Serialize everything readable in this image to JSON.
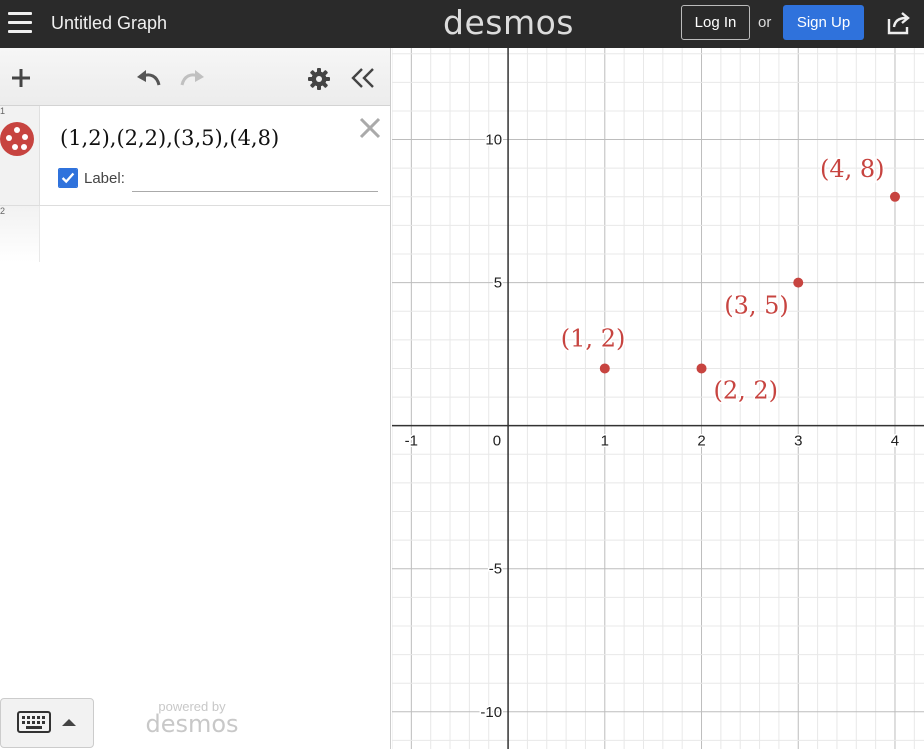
{
  "header": {
    "title": "Untitled Graph",
    "logo": "desmos",
    "login_label": "Log In",
    "or_text": "or",
    "signup_label": "Sign Up",
    "signup_color": "#2f72dc",
    "icons": [
      "hamburger-icon",
      "share-icon"
    ]
  },
  "toolbar": {
    "icons": [
      "plus-icon",
      "undo-icon",
      "redo-icon",
      "gear-icon",
      "collapse-icon"
    ]
  },
  "expressions": [
    {
      "index": "1",
      "latex": "(1,2),(2,2),(3,5),(4,8)",
      "color": "#c74440",
      "label_checked": true,
      "label_caption": "Label:",
      "label_value": ""
    },
    {
      "index": "2",
      "latex": ""
    }
  ],
  "footer": {
    "powered_by": "powered by",
    "brand": "desmos",
    "keypad_icon": "keyboard-icon"
  },
  "chart_data": {
    "type": "scatter",
    "xlim": [
      -1.2,
      4.3
    ],
    "ylim": [
      -11.3,
      13.2
    ],
    "x_ticks": [
      -1,
      0,
      1,
      2,
      3,
      4
    ],
    "y_ticks": [
      -10,
      -5,
      5,
      10
    ],
    "origin_label": "0",
    "grid": true,
    "series": [
      {
        "color": "#c74440",
        "points": [
          {
            "x": 1,
            "y": 2,
            "label": "(1, 2)"
          },
          {
            "x": 2,
            "y": 2,
            "label": "(2, 2)"
          },
          {
            "x": 3,
            "y": 5,
            "label": "(3, 5)"
          },
          {
            "x": 4,
            "y": 8,
            "label": "(4, 8)"
          }
        ]
      }
    ]
  }
}
